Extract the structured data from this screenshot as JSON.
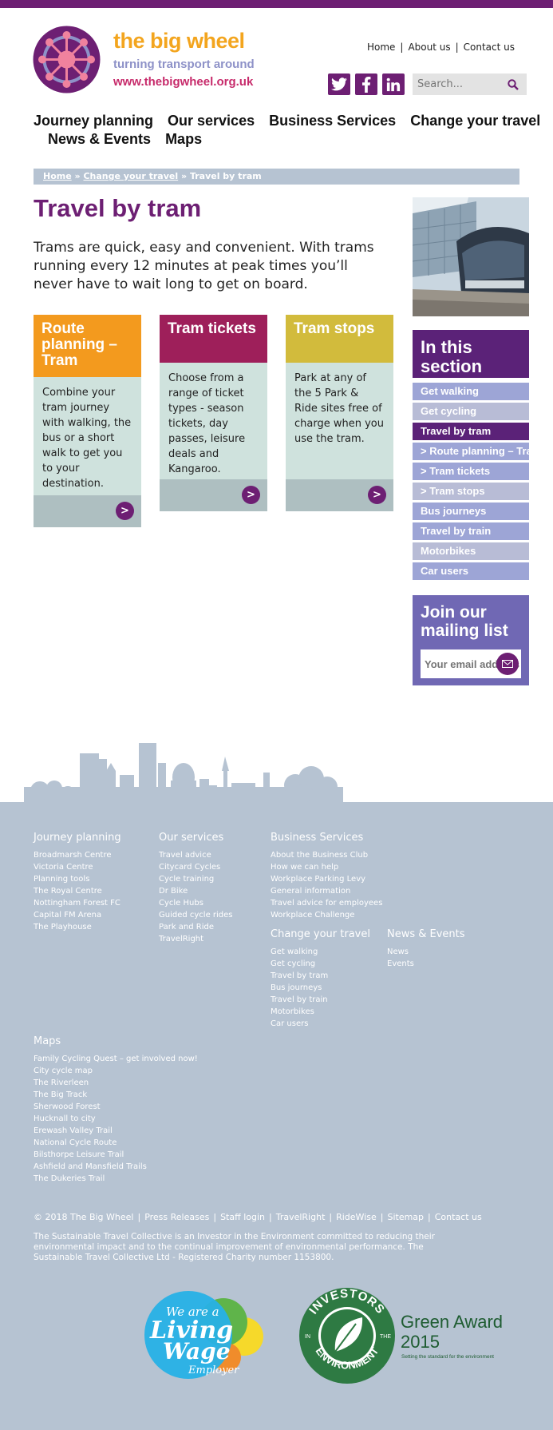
{
  "brand": {
    "title": "the big wheel",
    "tagline": "turning transport around",
    "url": "www.thebigwheel.org.uk",
    "colors": {
      "purple": "#6d1f73",
      "orange": "#f3a51e",
      "lilac": "#8e92c8",
      "pink": "#c72b6b"
    }
  },
  "util_links": [
    "Home",
    "About us",
    "Contact us"
  ],
  "social": [
    "twitter-icon",
    "facebook-icon",
    "linkedin-icon"
  ],
  "search": {
    "placeholder": "Search..."
  },
  "nav": {
    "row1": [
      "Journey planning",
      "Our services",
      "Business Services",
      "Change your travel"
    ],
    "row2": [
      "News & Events",
      "Maps"
    ]
  },
  "breadcrumb": {
    "home": "Home",
    "parent": "Change your travel",
    "current": "Travel by tram",
    "sep": "»"
  },
  "page": {
    "title": "Travel by tram",
    "intro": "Trams are quick, easy and convenient.  With trams running every 12 minutes at peak times you’ll never have to wait long to get on board."
  },
  "cards": [
    {
      "title": "Route planning – Tram",
      "body": "Combine your tram journey with walking, the bus or a short walk to get you to your destination.",
      "color": "#f39a1e"
    },
    {
      "title": "Tram tickets",
      "body": "Choose from a range of ticket types - season tickets, day passes, leisure deals and Kangaroo.",
      "color": "#9e1f5a"
    },
    {
      "title": "Tram stops",
      "body": "Park at any of the 5 Park & Ride sites free of charge when you use the tram.",
      "color": "#d2bb3c"
    }
  ],
  "section": {
    "title": "In this section",
    "items": [
      "Get walking",
      "Get cycling",
      "Travel by tram",
      "> Route planning – Tram",
      "> Tram tickets",
      "> Tram stops",
      "Bus journeys",
      "Travel by train",
      "Motorbikes",
      "Car users"
    ]
  },
  "mailing": {
    "title": "Join our mailing list",
    "placeholder": "Your email address"
  },
  "footer": {
    "journey": {
      "title": "Journey planning",
      "links": [
        "Broadmarsh Centre",
        "Victoria Centre",
        "Planning tools",
        "The Royal Centre",
        "Nottingham Forest FC",
        "Capital FM Arena",
        "The Playhouse"
      ]
    },
    "services": {
      "title": "Our services",
      "links": [
        "Travel advice",
        "Citycard Cycles",
        "Cycle training",
        "Dr Bike",
        "Cycle Hubs",
        "Guided cycle rides",
        "Park and Ride",
        "TravelRight"
      ]
    },
    "business": {
      "title": "Business Services",
      "links": [
        "About the Business Club",
        "How we can help",
        "Workplace Parking Levy",
        "General information",
        "Travel advice for employees",
        "Workplace Challenge"
      ]
    },
    "change": {
      "title": "Change your travel",
      "links": [
        "Get walking",
        "Get cycling",
        "Travel by tram",
        "Bus journeys",
        "Travel by train",
        "Motorbikes",
        "Car users"
      ]
    },
    "news": {
      "title": "News & Events",
      "links": [
        "News",
        "Events"
      ]
    },
    "maps": {
      "title": "Maps",
      "links": [
        "Family Cycling Quest – get involved now!",
        "City cycle map",
        "The Riverleen",
        "The Big Track",
        "Sherwood Forest",
        "Hucknall to city",
        "Erewash Valley Trail",
        "National Cycle Route",
        "Bilsthorpe Leisure Trail",
        "Ashfield and Mansfield Trails",
        "The Dukeries Trail"
      ]
    },
    "bottom_links": [
      "© 2018 The Big Wheel",
      "Press Releases",
      "Staff login",
      "TravelRight",
      "RideWise",
      "Sitemap",
      "Contact us"
    ],
    "note": "The Sustainable Travel Collective is an Investor in the Environment committed to reducing their environmental impact and to the continual improvement of environmental performance. The Sustainable Travel Collective Ltd - Registered Charity number 1153800.",
    "living_wage": {
      "line1": "We are a",
      "line2": "Living",
      "line3": "Wage",
      "line4": "Employer"
    },
    "iie": {
      "ring_top": "INVESTORS",
      "ring_in": "IN",
      "ring_the": "THE",
      "ring_bottom": "ENVIRONMENT",
      "award": "Green Award",
      "year": "2015",
      "strap": "Setting the standard for the environment"
    }
  }
}
